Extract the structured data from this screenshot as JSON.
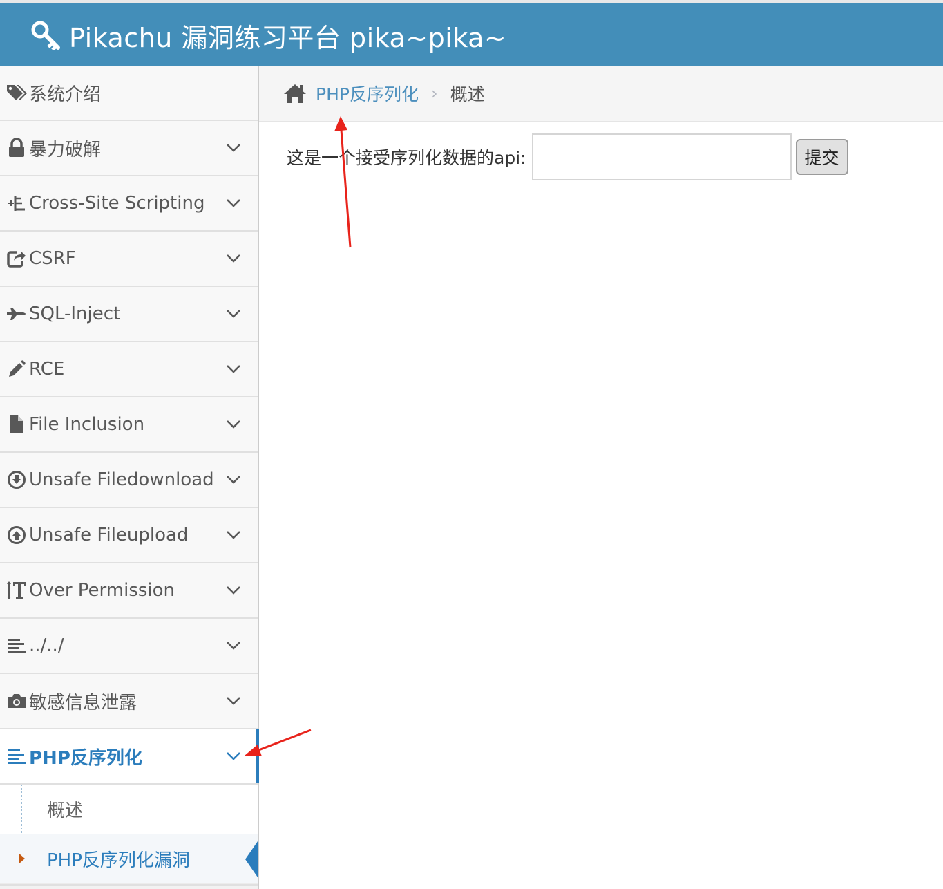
{
  "header": {
    "title": "Pikachu 漏洞练习平台 pika~pika~",
    "icon": "key-icon",
    "bg_color": "#438eb9"
  },
  "sidebar": {
    "intro": {
      "label": "系统介绍",
      "icon": "tags-icon"
    },
    "items": [
      {
        "label": "暴力破解",
        "icon": "lock-icon"
      },
      {
        "label": "Cross-Site Scripting",
        "icon": "code-fork-icon"
      },
      {
        "label": "CSRF",
        "icon": "share-square-icon"
      },
      {
        "label": "SQL-Inject",
        "icon": "fighter-jet-icon"
      },
      {
        "label": "RCE",
        "icon": "pencil-icon"
      },
      {
        "label": "File Inclusion",
        "icon": "file-icon"
      },
      {
        "label": "Unsafe Filedownload",
        "icon": "download-circle-icon"
      },
      {
        "label": "Unsafe Fileupload",
        "icon": "upload-circle-icon"
      },
      {
        "label": "Over Permission",
        "icon": "text-height-icon"
      },
      {
        "label": "../../",
        "icon": "align-left-icon"
      },
      {
        "label": "敏感信息泄露",
        "icon": "camera-icon"
      }
    ],
    "active": {
      "label": "PHP反序列化",
      "icon": "align-left-icon",
      "children": [
        {
          "label": "概述"
        },
        {
          "label": "PHP反序列化漏洞"
        }
      ]
    },
    "active_color": "#2b7dbc"
  },
  "breadcrumb": {
    "home_icon": "home-icon",
    "link": "PHP反序列化",
    "current": "概述"
  },
  "form": {
    "label": "这是一个接受序列化数据的api:",
    "input_value": "",
    "submit": "提交"
  },
  "annotation_color": "#e8231b"
}
